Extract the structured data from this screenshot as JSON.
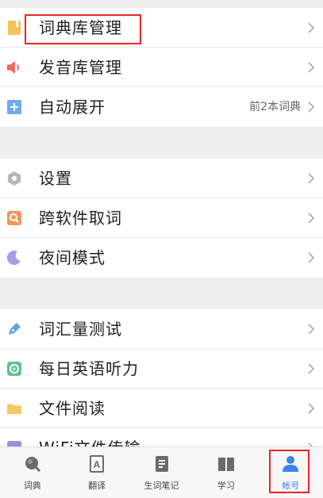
{
  "settings": {
    "group1": [
      {
        "label": "词典库管理",
        "value": "",
        "icon": "dictionary-book-icon",
        "color": "#f5c25a"
      },
      {
        "label": "发音库管理",
        "value": "",
        "icon": "speaker-icon",
        "color": "#ea6b5b"
      },
      {
        "label": "自动展开",
        "value": "前2本词典",
        "icon": "plus-icon",
        "color": "#6fa9ee"
      }
    ],
    "group2": [
      {
        "label": "设置",
        "icon": "settings-hexagon-icon",
        "color": "#b7b7b7"
      },
      {
        "label": "跨软件取词",
        "icon": "search-icon",
        "color": "#f0955c"
      },
      {
        "label": "夜间模式",
        "icon": "moon-icon",
        "color": "#a99be6"
      }
    ],
    "group3": [
      {
        "label": "词汇量测试",
        "icon": "pen-icon",
        "color": "#5aa3e8"
      },
      {
        "label": "每日英语听力",
        "icon": "audio-disc-icon",
        "color": "#5cc48e"
      },
      {
        "label": "文件阅读",
        "icon": "folder-icon",
        "color": "#f6c861"
      },
      {
        "label": "WiFi文件传输",
        "icon": "wifi-transfer-icon",
        "color": "#9b8de0"
      }
    ]
  },
  "tabbar": {
    "tabs": [
      {
        "label": "词典",
        "icon": "dictionary-search-icon",
        "active": false
      },
      {
        "label": "翻译",
        "icon": "translate-icon",
        "active": false
      },
      {
        "label": "生词笔记",
        "icon": "notes-icon",
        "active": false
      },
      {
        "label": "学习",
        "icon": "learn-book-icon",
        "active": false
      },
      {
        "label": "帐号",
        "icon": "account-icon",
        "active": true
      }
    ]
  },
  "colors": {
    "accent": "#3a86e6",
    "highlight": "#e8262a"
  }
}
